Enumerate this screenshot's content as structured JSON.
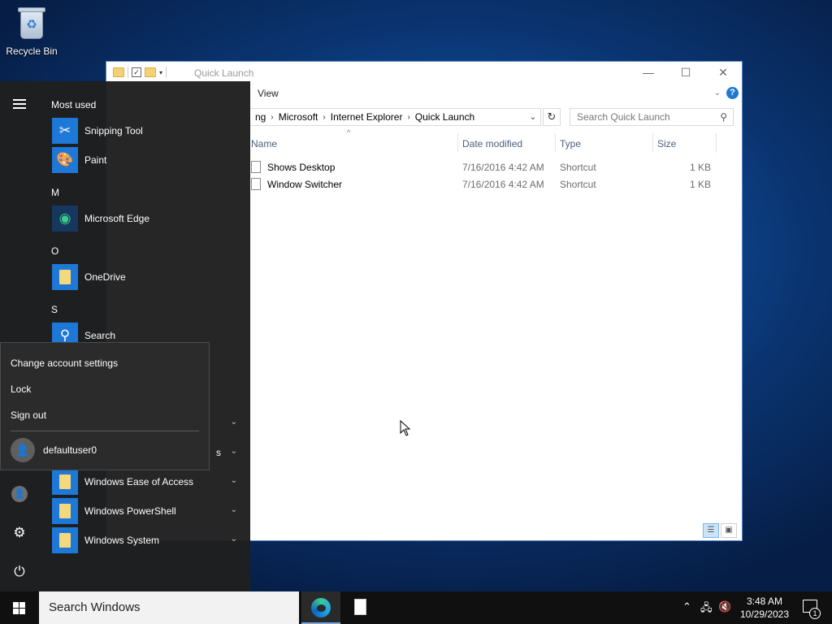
{
  "desktop": {
    "recycle_bin_label": "Recycle Bin"
  },
  "explorer": {
    "title": "Quick Launch",
    "ribbon_tab": "View",
    "breadcrumb": [
      "ng",
      "Microsoft",
      "Internet Explorer",
      "Quick Launch"
    ],
    "search_placeholder": "Search Quick Launch",
    "columns": {
      "name": "Name",
      "date": "Date modified",
      "type": "Type",
      "size": "Size"
    },
    "files": [
      {
        "name": "Shows Desktop",
        "date": "7/16/2016 4:42 AM",
        "type": "Shortcut",
        "size": "1 KB"
      },
      {
        "name": "Window Switcher",
        "date": "7/16/2016 4:42 AM",
        "type": "Shortcut",
        "size": "1 KB"
      }
    ],
    "window_buttons": {
      "minimize": "—",
      "maximize": "☐",
      "close": "✕"
    }
  },
  "start_menu": {
    "most_used_header": "Most used",
    "most_used": [
      {
        "name": "Snipping Tool",
        "icon": "scissors-icon"
      },
      {
        "name": "Paint",
        "icon": "palette-icon"
      }
    ],
    "groups": [
      {
        "letter": "M",
        "apps": [
          {
            "name": "Microsoft Edge",
            "icon": "edge-icon"
          }
        ]
      },
      {
        "letter": "O",
        "apps": [
          {
            "name": "OneDrive",
            "icon": "onedrive-icon"
          }
        ]
      },
      {
        "letter": "S",
        "apps": [
          {
            "name": "Search",
            "icon": "search-icon"
          }
        ]
      }
    ],
    "partial_item_tail": "s",
    "folders": [
      {
        "name": "Windows Ease of Access"
      },
      {
        "name": "Windows PowerShell"
      },
      {
        "name": "Windows System"
      }
    ]
  },
  "account_flyout": {
    "change_settings": "Change account settings",
    "lock": "Lock",
    "sign_out": "Sign out",
    "username": "defaultuser0"
  },
  "taskbar": {
    "search_text": "Search Windows",
    "time": "3:48 AM",
    "date": "10/29/2023",
    "notification_count": "1"
  },
  "colors": {
    "accent": "#1e78d7",
    "taskbar": "#101010",
    "start_menu": "#1f1f1f"
  }
}
